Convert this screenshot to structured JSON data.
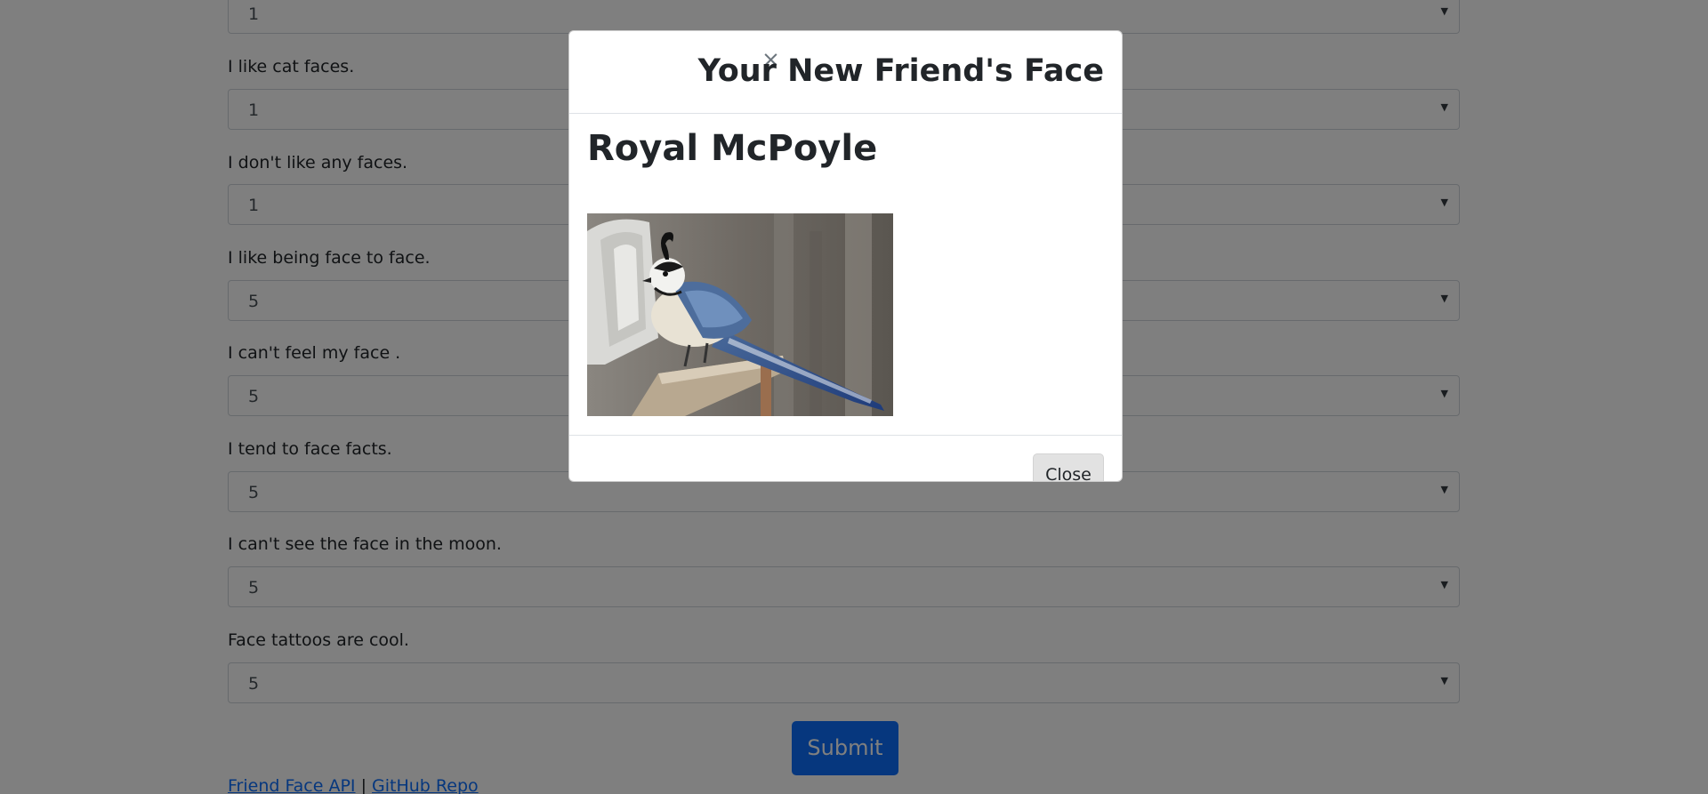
{
  "questions": [
    {
      "label": "",
      "value": "1"
    },
    {
      "label": "I like cat faces.",
      "value": "1"
    },
    {
      "label": "I don't like any faces.",
      "value": "1"
    },
    {
      "label": "I like being face to face.",
      "value": "5"
    },
    {
      "label": "I can't feel my face .",
      "value": "5"
    },
    {
      "label": "I tend to face facts.",
      "value": "5"
    },
    {
      "label": "I can't see the face in the moon.",
      "value": "5"
    },
    {
      "label": "Face tattoos are cool.",
      "value": "5"
    }
  ],
  "submit_label": "Submit",
  "footer": {
    "api_link": "Friend Face API",
    "separator": "|",
    "repo_link": "GitHub Repo"
  },
  "modal": {
    "close_icon": "×",
    "title": "Your New Friend's Face",
    "friend_name": "Royal McPoyle",
    "close_button": "Close"
  },
  "colors": {
    "primary": "#0d6efd",
    "backdrop": "rgba(0,0,0,0.5)"
  }
}
